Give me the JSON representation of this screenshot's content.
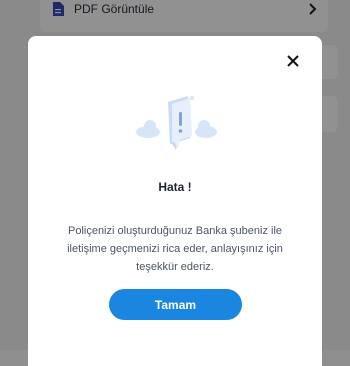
{
  "background": {
    "item_label": "PDF Görüntüle",
    "item_icon": "document-icon",
    "chevron_icon": "chevron-right-icon"
  },
  "dialog": {
    "title": "Hata !",
    "message": "Poliçenizi oluşturduğunuz Banka şubeniz ile iletişime geçmenizi rica eder, anlayışınız için teşekkür ederiz.",
    "button_label": "Tamam",
    "close_icon": "close-icon",
    "illustration": "error-chat-bubble-illustration",
    "colors": {
      "accent": "#1a86e0",
      "title": "#1f2430",
      "body": "#4c5565"
    }
  }
}
